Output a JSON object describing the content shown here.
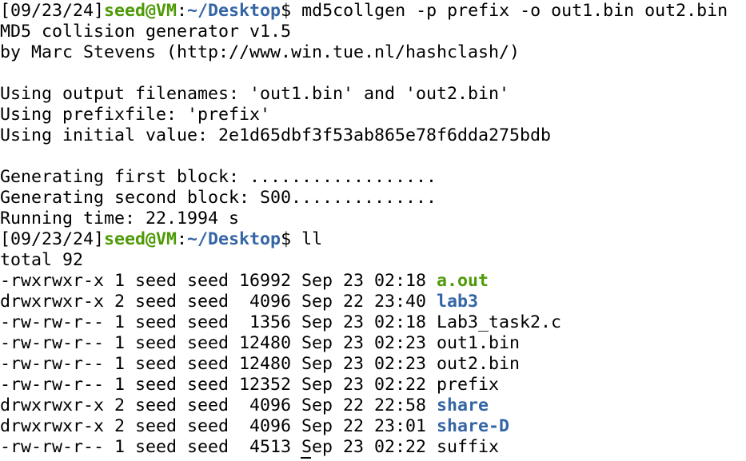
{
  "terminal": {
    "colors": {
      "background": "#ffffff",
      "text": "#000000",
      "prompt_user": "#4e9a06",
      "prompt_path": "#3465a4",
      "executable": "#4e9a06",
      "directory": "#3465a4"
    },
    "lines": [
      [
        {
          "t": "[09/23/24]",
          "c": "plain"
        },
        {
          "t": "seed@VM",
          "c": "userhost"
        },
        {
          "t": ":",
          "c": "plain"
        },
        {
          "t": "~/Desktop",
          "c": "path"
        },
        {
          "t": "$ md5collgen -p prefix -o out1.bin out2.bin",
          "c": "plain"
        }
      ],
      [
        {
          "t": "MD5 collision generator v1.5",
          "c": "plain"
        }
      ],
      [
        {
          "t": "by Marc Stevens (http://www.win.tue.nl/hashclash/)",
          "c": "plain"
        }
      ],
      [],
      [
        {
          "t": "Using output filenames: 'out1.bin' and 'out2.bin'",
          "c": "plain"
        }
      ],
      [
        {
          "t": "Using prefixfile: 'prefix'",
          "c": "plain"
        }
      ],
      [
        {
          "t": "Using initial value: 2e1d65dbf3f53ab865e78f6dda275bdb",
          "c": "plain"
        }
      ],
      [],
      [
        {
          "t": "Generating first block: ..................",
          "c": "plain"
        }
      ],
      [
        {
          "t": "Generating second block: S00..............",
          "c": "plain"
        }
      ],
      [
        {
          "t": "Running time: 22.1994 s",
          "c": "plain"
        }
      ],
      [
        {
          "t": "[09/23/24]",
          "c": "plain"
        },
        {
          "t": "seed@VM",
          "c": "userhost"
        },
        {
          "t": ":",
          "c": "plain"
        },
        {
          "t": "~/Desktop",
          "c": "path"
        },
        {
          "t": "$ ll",
          "c": "plain"
        }
      ],
      [
        {
          "t": "total 92",
          "c": "plain"
        }
      ],
      [
        {
          "t": "-rwxrwxr-x 1 seed seed 16992 Sep 23 02:18 ",
          "c": "plain"
        },
        {
          "t": "a.out",
          "c": "exe"
        }
      ],
      [
        {
          "t": "drwxrwxr-x 2 seed seed  4096 Sep 22 23:40 ",
          "c": "plain"
        },
        {
          "t": "lab3",
          "c": "dir"
        }
      ],
      [
        {
          "t": "-rw-rw-r-- 1 seed seed  1356 Sep 23 02:18 Lab3_task2.c",
          "c": "plain"
        }
      ],
      [
        {
          "t": "-rw-rw-r-- 1 seed seed 12480 Sep 23 02:23 out1.bin",
          "c": "plain"
        }
      ],
      [
        {
          "t": "-rw-rw-r-- 1 seed seed 12480 Sep 23 02:23 out2.bin",
          "c": "plain"
        }
      ],
      [
        {
          "t": "-rw-rw-r-- 1 seed seed 12352 Sep 23 02:22 prefix",
          "c": "plain"
        }
      ],
      [
        {
          "t": "drwxrwxr-x 2 seed seed  4096 Sep 22 22:58 ",
          "c": "plain"
        },
        {
          "t": "share",
          "c": "dir"
        }
      ],
      [
        {
          "t": "drwxrwxr-x 2 seed seed  4096 Sep 22 23:01 ",
          "c": "plain"
        },
        {
          "t": "share-D",
          "c": "dir"
        }
      ],
      [
        {
          "t": "-rw-rw-r-- 1 seed seed  4513 Sep 23 02:22 suffix",
          "c": "plain"
        }
      ]
    ]
  }
}
